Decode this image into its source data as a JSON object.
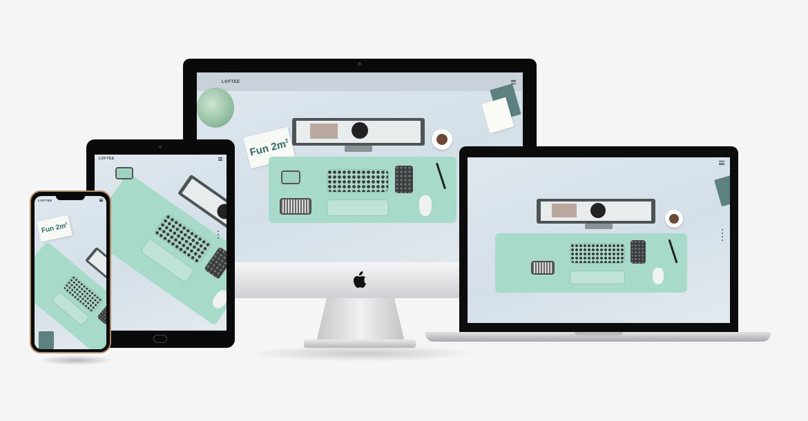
{
  "site": {
    "logo": "LOFTEE",
    "headline": "Fun 2m",
    "headline_superscript": "2",
    "monitor_logo_glyph": "1"
  },
  "icons": {
    "menu": "hamburger-menu-icon",
    "apple": "apple-logo-icon",
    "camera": "camera-icon"
  },
  "colors": {
    "background": "#f5f5f5",
    "site_background": "#dbe4eb",
    "mat": "#a8dac9",
    "accent_text": "#2f6a68",
    "device_bezel": "#0a0a0a"
  }
}
